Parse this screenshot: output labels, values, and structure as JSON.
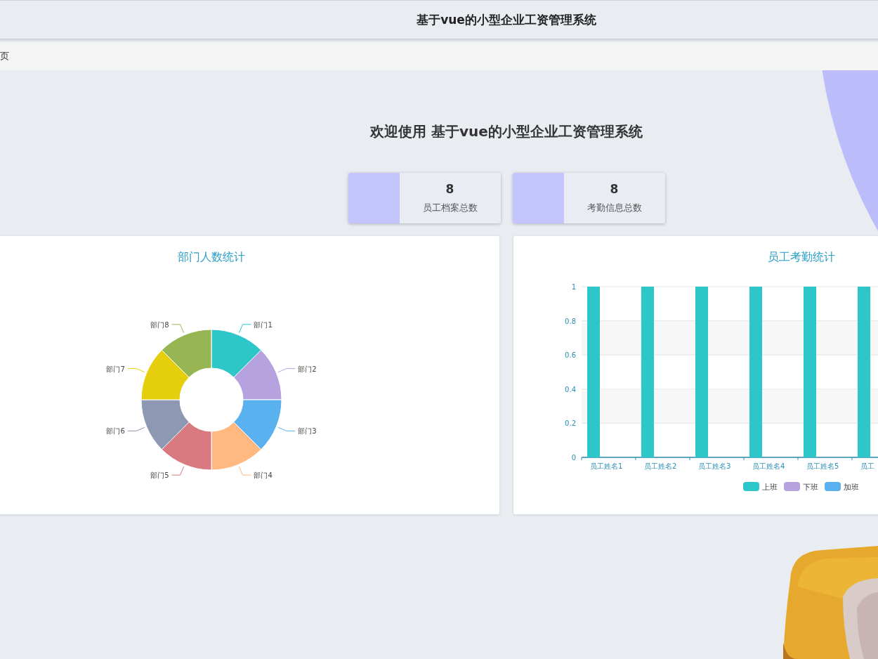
{
  "header": {
    "title": "基于vue的小型企业工资管理系统"
  },
  "breadcrumb": {
    "items": [
      "页"
    ]
  },
  "welcome": {
    "text": "欢迎使用 基于vue的小型企业工资管理系统"
  },
  "stats": [
    {
      "value": "8",
      "label": "员工档案总数"
    },
    {
      "value": "8",
      "label": "考勤信息总数"
    }
  ],
  "charts": [
    {
      "chart_data": {
        "type": "donut",
        "title": "部门人数统计",
        "categories": [
          "部门1",
          "部门2",
          "部门3",
          "部门4",
          "部门5",
          "部门6",
          "部门7",
          "部门8"
        ],
        "values": [
          1,
          1,
          1,
          1,
          1,
          1,
          1,
          1
        ],
        "colors": [
          "#2ec7c9",
          "#b6a2de",
          "#5ab1ef",
          "#ffb980",
          "#d87a80",
          "#8d98b3",
          "#e5cf0d",
          "#97b552"
        ]
      }
    },
    {
      "chart_data": {
        "type": "bar",
        "title": "员工考勤统计",
        "grid": true,
        "categories": [
          "员工姓名1",
          "员工姓名2",
          "员工姓名3",
          "员工姓名4",
          "员工姓名5",
          "员工"
        ],
        "ylim": [
          0,
          1
        ],
        "yticks": [
          0,
          0.2,
          0.4,
          0.6,
          0.8,
          1
        ],
        "series": [
          {
            "name": "上班",
            "color": "#2ec7c9",
            "values": [
              1,
              1,
              1,
              1,
              1,
              1
            ]
          },
          {
            "name": "下班",
            "color": "#b6a2de",
            "values": [
              0,
              0,
              0,
              0,
              0,
              0
            ]
          },
          {
            "name": "加班",
            "color": "#5ab1ef",
            "values": [
              0,
              0,
              0,
              0,
              0,
              0
            ]
          }
        ]
      }
    }
  ]
}
